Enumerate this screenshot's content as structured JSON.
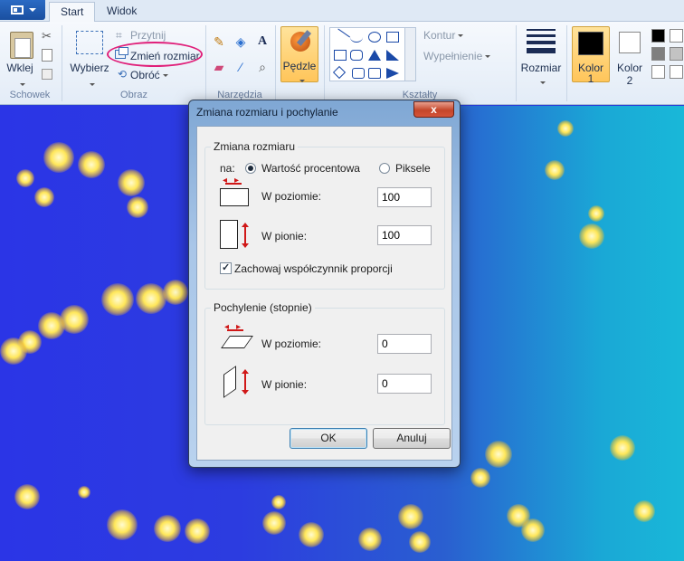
{
  "ribbon": {
    "tabs": [
      {
        "label": "Start"
      },
      {
        "label": "Widok"
      }
    ],
    "clipboard": {
      "paste_label": "Wklej",
      "group_label": "Schowek"
    },
    "image": {
      "select_label": "Wybierz",
      "crop_label": "Przytnij",
      "resize_label": "Zmień rozmiar",
      "rotate_label": "Obróć",
      "group_label": "Obraz"
    },
    "tools": {
      "group_label": "Narzędzia",
      "text_tool_glyph": "A"
    },
    "brushes": {
      "label": "Pędzle"
    },
    "shapes": {
      "outline_label": "Kontur",
      "fill_label": "Wypełnienie",
      "group_label": "Kształty"
    },
    "size": {
      "label": "Rozmiar"
    },
    "colors": {
      "color1_label": "Kolor",
      "color1_number": "1",
      "color2_label": "Kolor",
      "color2_number": "2",
      "palette": [
        "#000000",
        "#7f7f7f",
        "#ffffff",
        "#c3c3c3",
        "#ffffff",
        "#c3c3c3"
      ]
    }
  },
  "dialog": {
    "title": "Zmiana rozmiaru i pochylanie",
    "close_glyph": "x",
    "resize": {
      "legend": "Zmiana rozmiaru",
      "by_label": "na:",
      "percent_label": "Wartość procentowa",
      "pixels_label": "Piksele",
      "selected_unit": "percent",
      "horizontal_label": "W poziomie:",
      "horizontal_value": "100",
      "vertical_label": "W pionie:",
      "vertical_value": "100",
      "keep_ratio_label": "Zachowaj współczynnik proporcji",
      "keep_ratio_checked": true
    },
    "skew": {
      "legend": "Pochylenie (stopnie)",
      "horizontal_label": "W poziomie:",
      "horizontal_value": "0",
      "vertical_label": "W pionie:",
      "vertical_value": "0"
    },
    "ok_label": "OK",
    "cancel_label": "Anuluj"
  },
  "colors": {
    "highlight_oval": "#e0207a",
    "accent_active": "#ffc55a"
  }
}
